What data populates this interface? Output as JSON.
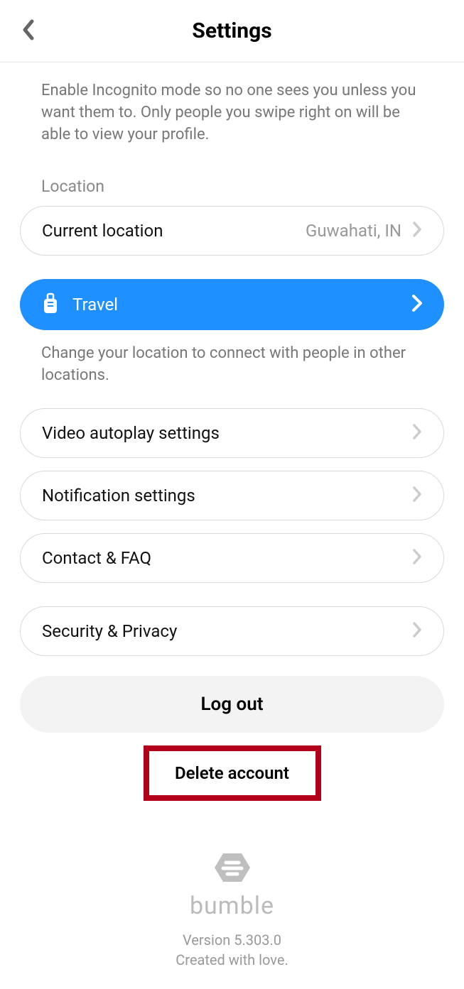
{
  "header": {
    "title": "Settings"
  },
  "incognito_desc": "Enable Incognito mode so no one sees you unless you want them to. Only people you swipe right on will be able to view your profile.",
  "location": {
    "label": "Location",
    "current_label": "Current location",
    "current_value": "Guwahati, IN"
  },
  "travel": {
    "label": "Travel",
    "desc": "Change your location to connect with people in other locations."
  },
  "rows": {
    "video": "Video autoplay settings",
    "notifications": "Notification settings",
    "contact": "Contact & FAQ",
    "security": "Security & Privacy"
  },
  "logout_label": "Log out",
  "delete_label": "Delete account",
  "footer": {
    "brand": "bumble",
    "version": "Version 5.303.0",
    "created": "Created with love."
  }
}
